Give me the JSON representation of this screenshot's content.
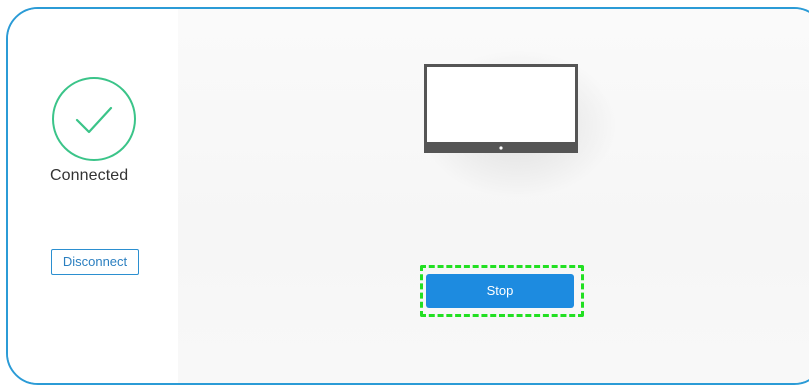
{
  "connection": {
    "status_label": "Connected",
    "status_icon": "check-circle-icon",
    "disconnect_label": "Disconnect"
  },
  "cast": {
    "device_icon": "monitor-icon",
    "stop_label": "Stop"
  },
  "colors": {
    "frame_border": "#2b9bd6",
    "success_green": "#3bc489",
    "primary_blue": "#1d8be0",
    "highlight_green": "#22e022"
  }
}
